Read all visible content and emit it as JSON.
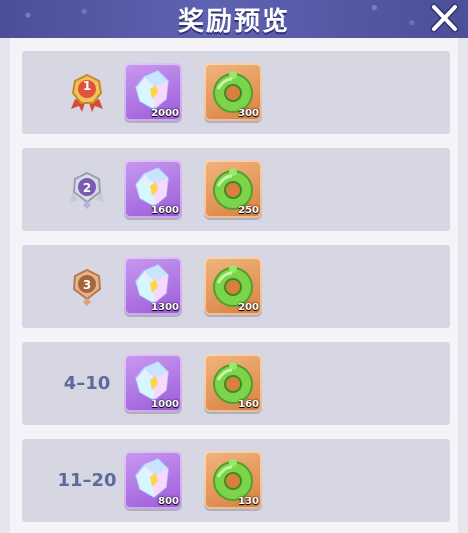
{
  "header": {
    "title": "奖励预览"
  },
  "rows": [
    {
      "rank_label": "1",
      "badge": "gold-medal-icon",
      "items": [
        {
          "icon": "crystal-gem-icon",
          "qty": "2000"
        },
        {
          "icon": "jade-ring-icon",
          "qty": "300"
        }
      ]
    },
    {
      "rank_label": "2",
      "badge": "silver-medal-icon",
      "items": [
        {
          "icon": "crystal-gem-icon",
          "qty": "1600"
        },
        {
          "icon": "jade-ring-icon",
          "qty": "250"
        }
      ]
    },
    {
      "rank_label": "3",
      "badge": "bronze-medal-icon",
      "items": [
        {
          "icon": "crystal-gem-icon",
          "qty": "1300"
        },
        {
          "icon": "jade-ring-icon",
          "qty": "200"
        }
      ]
    },
    {
      "rank_label": "4–10",
      "badge": null,
      "items": [
        {
          "icon": "crystal-gem-icon",
          "qty": "1000"
        },
        {
          "icon": "jade-ring-icon",
          "qty": "160"
        }
      ]
    },
    {
      "rank_label": "11–20",
      "badge": null,
      "items": [
        {
          "icon": "crystal-gem-icon",
          "qty": "800"
        },
        {
          "icon": "jade-ring-icon",
          "qty": "130"
        }
      ]
    }
  ],
  "colors": {
    "header": "#555aa8",
    "row": "#d7d6e3",
    "rank_text": "#5c6a9c",
    "gem_frame": "#a867e0",
    "ring_frame": "#e08f4a"
  }
}
